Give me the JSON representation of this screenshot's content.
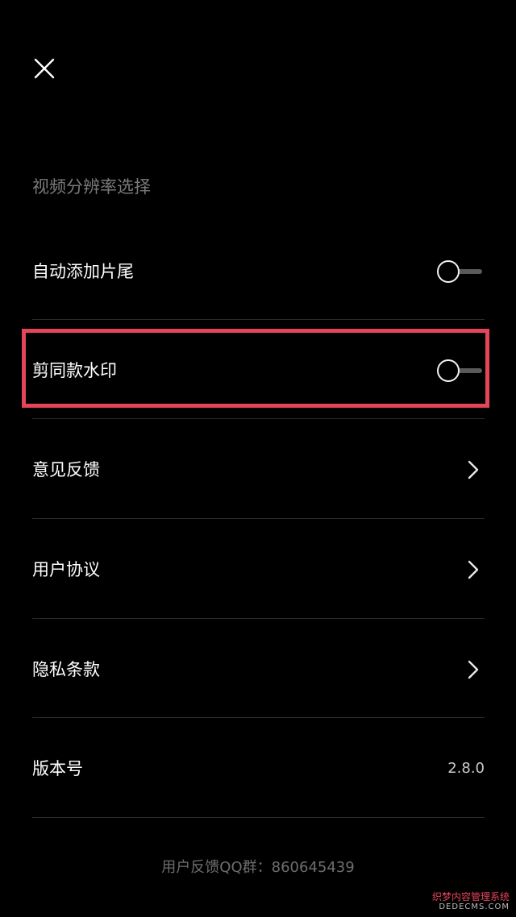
{
  "header": {
    "close_icon": "close-icon"
  },
  "section": {
    "title": "视频分辨率选择"
  },
  "settings": {
    "auto_ending": {
      "label": "自动添加片尾",
      "enabled": false
    },
    "watermark": {
      "label": "剪同款水印",
      "enabled": false
    },
    "feedback": {
      "label": "意见反馈",
      "icon": "chevron-right-icon"
    },
    "user_agreement": {
      "label": "用户协议",
      "icon": "chevron-right-icon"
    },
    "privacy": {
      "label": "隐私条款",
      "icon": "chevron-right-icon"
    },
    "version": {
      "label": "版本号",
      "value": "2.8.0"
    }
  },
  "footer": {
    "text": "用户反馈QQ群：860645439"
  },
  "overlay": {
    "watermark_cn": "织梦内容管理系统",
    "watermark_en": "DEDECMS.COM"
  },
  "colors": {
    "background": "#000000",
    "highlight": "#e5455a",
    "secondary_text": "#7a7a7a"
  }
}
